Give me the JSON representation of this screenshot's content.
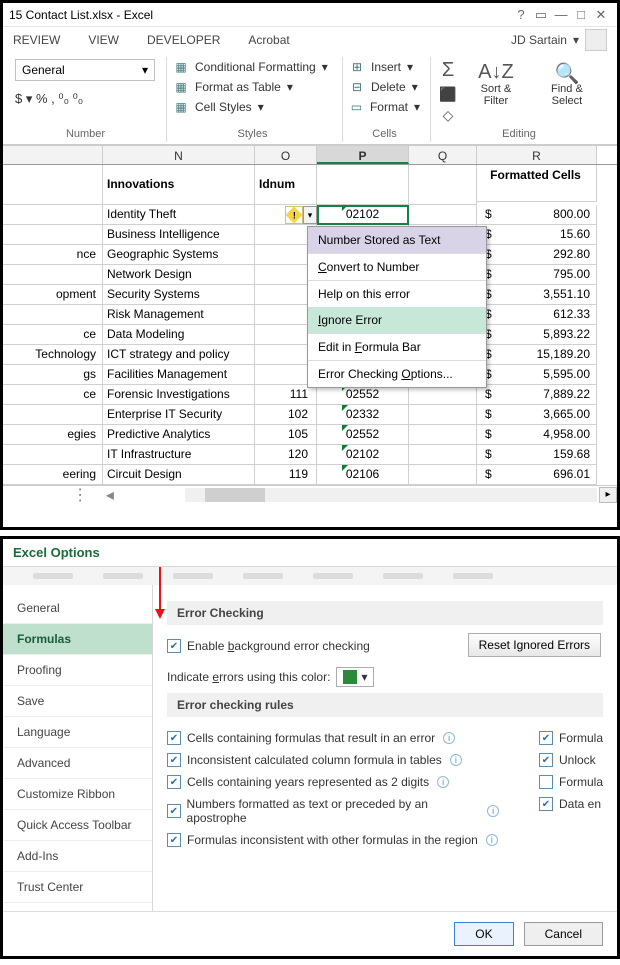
{
  "window": {
    "title": "15 Contact List.xlsx - Excel",
    "user": "JD Sartain"
  },
  "menubar": [
    "REVIEW",
    "VIEW",
    "DEVELOPER",
    "Acrobat"
  ],
  "ribbon": {
    "number_format": "General",
    "number_glyphs": "$ ▾ % ,  ⁰₀ ⁰₀",
    "styles": {
      "cond": "Conditional Formatting",
      "table": "Format as Table",
      "cell": "Cell Styles"
    },
    "cells": {
      "insert": "Insert",
      "delete": "Delete",
      "format": "Format"
    },
    "editing": {
      "sort": "Sort & Filter",
      "find": "Find & Select"
    },
    "group_labels": {
      "number": "Number",
      "styles": "Styles",
      "cells": "Cells",
      "editing": "Editing"
    }
  },
  "columns": [
    "N",
    "O",
    "P",
    "Q",
    "R"
  ],
  "header_row": {
    "n": "Innovations",
    "o": "Idnum",
    "p": "",
    "q": "",
    "r": "Formatted Cells"
  },
  "active_cell_value": "02102",
  "rows": [
    {
      "rh": "",
      "n": "Identity Theft",
      "o": "",
      "p": "02102",
      "r": "800.00"
    },
    {
      "rh": "",
      "n": "Business Intelligence",
      "o": "",
      "p": "",
      "r": "15.60"
    },
    {
      "rh": "nce",
      "n": "Geographic Systems",
      "o": "",
      "p": "",
      "r": "292.80"
    },
    {
      "rh": "",
      "n": "Network Design",
      "o": "",
      "p": "",
      "r": "795.00"
    },
    {
      "rh": "opment",
      "n": "Security Systems",
      "o": "",
      "p": "",
      "r": "3,551.10"
    },
    {
      "rh": "",
      "n": "Risk Management",
      "o": "",
      "p": "",
      "r": "612.33"
    },
    {
      "rh": "ce",
      "n": "Data Modeling",
      "o": "",
      "p": "",
      "r": "5,893.22"
    },
    {
      "rh": "Technology",
      "n": "ICT strategy and policy",
      "o": "",
      "p": "",
      "r": "15,189.20"
    },
    {
      "rh": "gs",
      "n": "Facilities Management",
      "o": "",
      "p": "",
      "r": "5,595.00"
    },
    {
      "rh": "ce",
      "n": "Forensic Investigations",
      "o": "111",
      "p": "02552",
      "r": "7,889.22"
    },
    {
      "rh": "",
      "n": "Enterprise IT Security",
      "o": "102",
      "p": "02332",
      "r": "3,665.00"
    },
    {
      "rh": "egies",
      "n": "Predictive Analytics",
      "o": "105",
      "p": "02552",
      "r": "4,958.00"
    },
    {
      "rh": "",
      "n": "IT Infrastructure",
      "o": "120",
      "p": "02102",
      "r": "159.68"
    },
    {
      "rh": "eering",
      "n": "Circuit Design",
      "o": "119",
      "p": "02106",
      "r": "696.01"
    }
  ],
  "context_menu": {
    "header": "Number Stored as Text",
    "items": [
      "Convert to Number",
      "Help on this error",
      "Ignore Error",
      "Edit in Formula Bar",
      "Error Checking Options..."
    ],
    "hover_index": 2
  },
  "options_dialog": {
    "title": "Excel Options",
    "nav": [
      "General",
      "Formulas",
      "Proofing",
      "Save",
      "Language",
      "Advanced",
      "Customize Ribbon",
      "Quick Access Toolbar",
      "Add-Ins",
      "Trust Center"
    ],
    "nav_selected": 1,
    "section1": "Error Checking",
    "enable_bg": "Enable background error checking",
    "indicate": "Indicate errors using this color:",
    "reset": "Reset Ignored Errors",
    "section2": "Error checking rules",
    "rules_left": [
      "Cells containing formulas that result in an error",
      "Inconsistent calculated column formula in tables",
      "Cells containing years represented as 2 digits",
      "Numbers formatted as text or preceded by an apostrophe",
      "Formulas inconsistent with other formulas in the region"
    ],
    "rules_right": [
      "Formula",
      "Unlock",
      "Formula",
      "Data en"
    ],
    "rules_right_checked": [
      true,
      true,
      false,
      true
    ],
    "ok": "OK",
    "cancel": "Cancel"
  }
}
